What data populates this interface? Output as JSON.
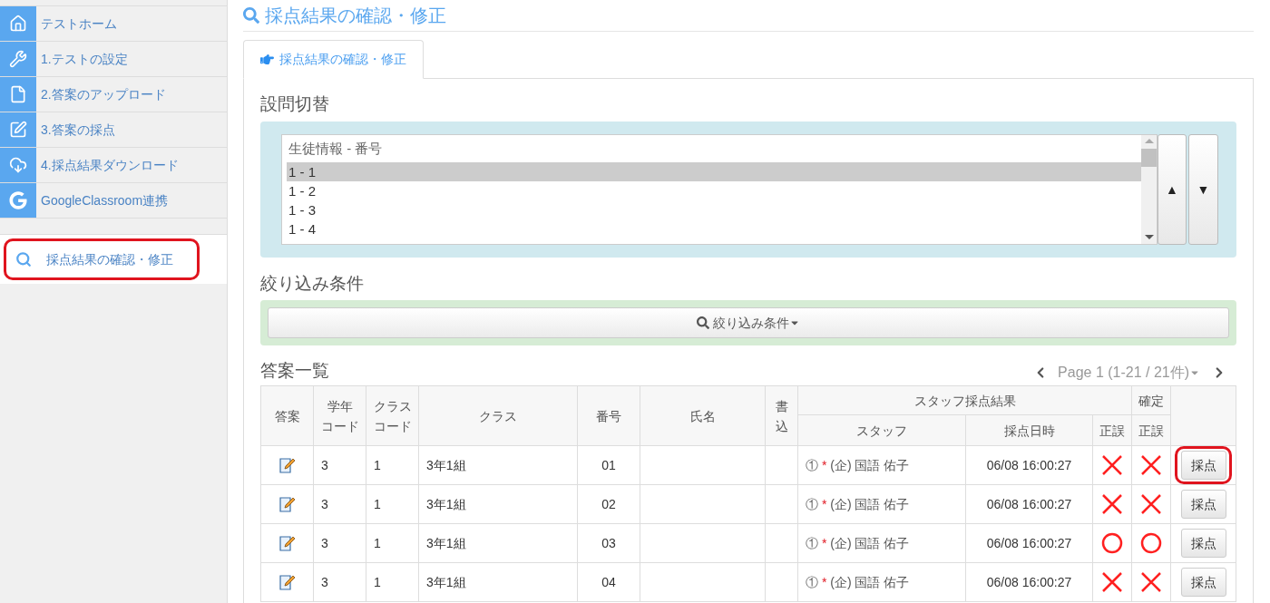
{
  "sidebar": {
    "items": [
      {
        "label": "テストホーム"
      },
      {
        "label": "1.テストの設定"
      },
      {
        "label": "2.答案のアップロード"
      },
      {
        "label": "3.答案の採点"
      },
      {
        "label": "4.採点結果ダウンロード"
      },
      {
        "label": "GoogleClassroom連携"
      }
    ],
    "search_item": {
      "label": "採点結果の確認・修正",
      "highlighted": true
    }
  },
  "page_title": "採点結果の確認・修正",
  "tabs": [
    {
      "label": "採点結果の確認・修正",
      "selected": true
    }
  ],
  "question_switch": {
    "heading": "設問切替",
    "list_header": "生徒情報 - 番号",
    "items": [
      {
        "label": "1 - 1",
        "selected": true
      },
      {
        "label": "1 - 2",
        "selected": false
      },
      {
        "label": "1 - 3",
        "selected": false
      },
      {
        "label": "1 - 4",
        "selected": false
      }
    ],
    "up_button": "▲",
    "down_button": "▼"
  },
  "filter": {
    "heading": "絞り込み条件",
    "button": "絞り込み条件"
  },
  "answers": {
    "heading": "答案一覧",
    "pager": "Page 1 (1-21 / 21件)",
    "columns": [
      {
        "lines": [
          "答案"
        ]
      },
      {
        "lines": [
          "学年",
          "コード"
        ]
      },
      {
        "lines": [
          "クラス",
          "コード"
        ]
      },
      {
        "lines": [
          "クラス"
        ]
      },
      {
        "lines": [
          "番号"
        ]
      },
      {
        "lines": [
          "氏名"
        ]
      },
      {
        "lines": [
          "書",
          "込"
        ]
      }
    ],
    "group_header": "スタッフ採点結果",
    "final_header": "確定",
    "sub_columns": [
      "スタッフ",
      "採点日時",
      "正誤"
    ],
    "final_sub": "正誤",
    "rows": [
      {
        "grade": "3",
        "class_code": "1",
        "class": "3年1組",
        "number": "01",
        "staff_no": "①",
        "staff_mark": "*",
        "staff": "(企) 国語 佑子",
        "datetime": "06/08 16:00:27",
        "staff_correct": false,
        "final_correct": false,
        "button": "採点",
        "highlighted": true
      },
      {
        "grade": "3",
        "class_code": "1",
        "class": "3年1組",
        "number": "02",
        "staff_no": "①",
        "staff_mark": "*",
        "staff": "(企) 国語 佑子",
        "datetime": "06/08 16:00:27",
        "staff_correct": false,
        "final_correct": false,
        "button": "採点",
        "highlighted": false
      },
      {
        "grade": "3",
        "class_code": "1",
        "class": "3年1組",
        "number": "03",
        "staff_no": "①",
        "staff_mark": "*",
        "staff": "(企) 国語 佑子",
        "datetime": "06/08 16:00:27",
        "staff_correct": true,
        "final_correct": true,
        "button": "採点",
        "highlighted": false
      },
      {
        "grade": "3",
        "class_code": "1",
        "class": "3年1組",
        "number": "04",
        "staff_no": "①",
        "staff_mark": "*",
        "staff": "(企) 国語 佑子",
        "datetime": "06/08 16:00:27",
        "staff_correct": false,
        "final_correct": false,
        "button": "採点",
        "highlighted": false
      }
    ]
  }
}
